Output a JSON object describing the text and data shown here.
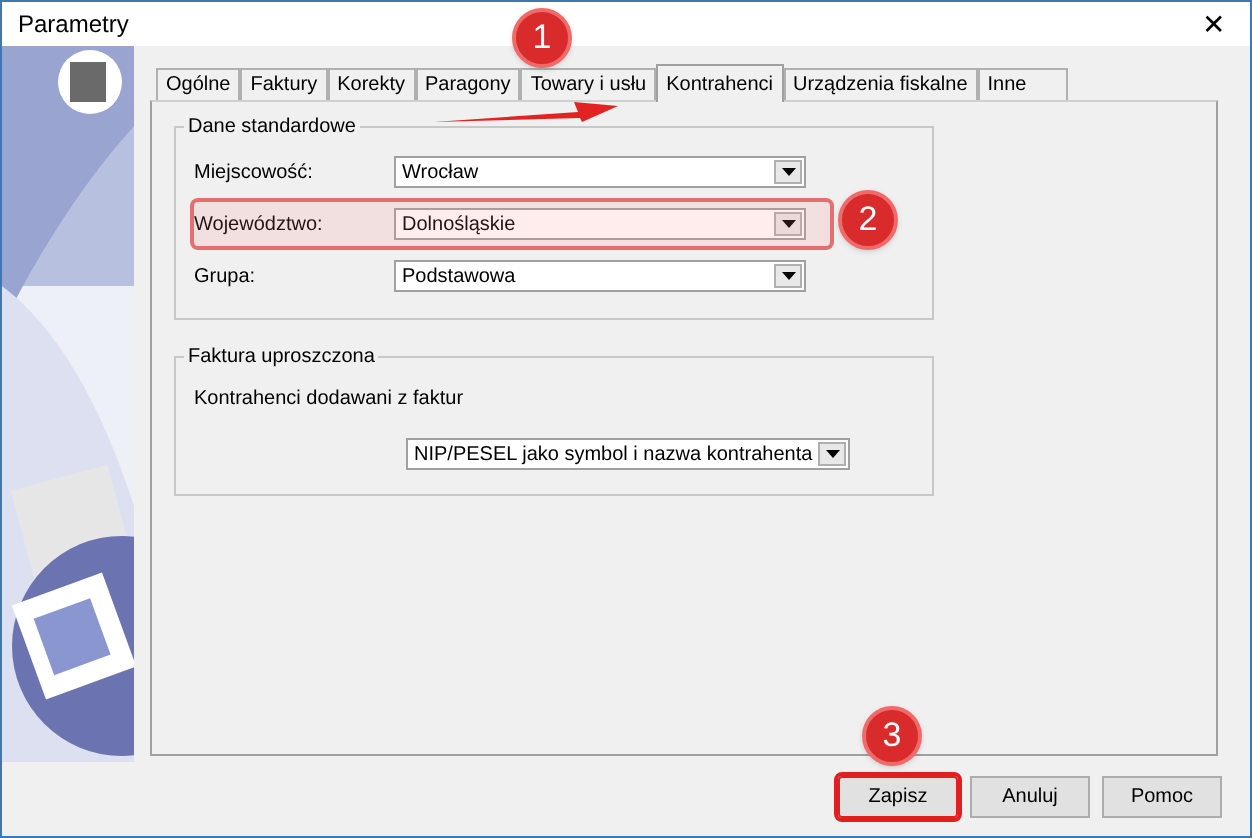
{
  "window": {
    "title": "Parametry",
    "close": "✕"
  },
  "tabs": [
    {
      "label": "Ogólne",
      "selected": false
    },
    {
      "label": "Faktury",
      "selected": false
    },
    {
      "label": "Korekty",
      "selected": false
    },
    {
      "label": "Paragony",
      "selected": false
    },
    {
      "label": "Towary i usłu",
      "selected": false
    },
    {
      "label": "Kontrahenci",
      "selected": true
    },
    {
      "label": "Urządzenia fiskalne",
      "selected": false
    },
    {
      "label": "Inne",
      "selected": false
    }
  ],
  "groups": [
    {
      "title": "Dane standardowe",
      "rows": [
        {
          "kind": "field",
          "label": "Miejscowość:",
          "value": "Wrocław",
          "highlighted": false
        },
        {
          "kind": "field",
          "label": "Województwo:",
          "value": "Dolnośląskie",
          "highlighted": true
        },
        {
          "kind": "field",
          "label": "Grupa:",
          "value": "Podstawowa",
          "highlighted": false
        }
      ]
    },
    {
      "title": "Faktura uproszczona",
      "rows": [
        {
          "kind": "caption",
          "label": "Kontrahenci dodawani z faktur"
        },
        {
          "kind": "dropdown",
          "value": "NIP/PESEL jako symbol i nazwa kontrahenta"
        }
      ]
    }
  ],
  "buttons": [
    {
      "label": "Zapisz",
      "highlighted": true
    },
    {
      "label": "Anuluj",
      "highlighted": false
    },
    {
      "label": "Pomoc",
      "highlighted": false
    }
  ],
  "annotations": [
    {
      "label": "1"
    },
    {
      "label": "2"
    },
    {
      "label": "3"
    }
  ]
}
